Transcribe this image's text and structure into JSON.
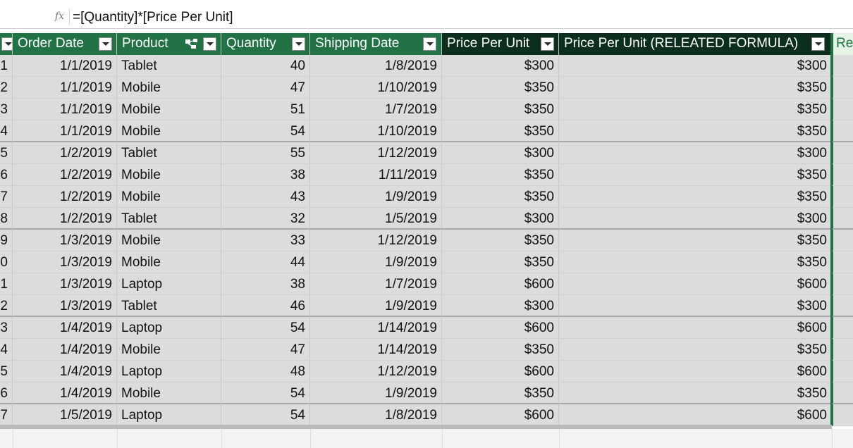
{
  "formula_bar": {
    "fx": "fx",
    "formula": "=[Quantity]*[Price Per Unit]"
  },
  "columns": [
    {
      "key": "id",
      "label": ""
    },
    {
      "key": "order_date",
      "label": "Order Date"
    },
    {
      "key": "product",
      "label": "Product"
    },
    {
      "key": "quantity",
      "label": "Quantity"
    },
    {
      "key": "shipping_date",
      "label": "Shipping Date"
    },
    {
      "key": "price",
      "label": "Price Per Unit"
    },
    {
      "key": "related_price",
      "label": "Price Per Unit (RELEATED FORMULA)"
    },
    {
      "key": "revenue",
      "label": "Rev"
    }
  ],
  "colors": {
    "header_green": "#217346",
    "header_dark": "#0b2f1c",
    "selected_header_bg": "#e4f3e4",
    "selected_header_text": "#217346",
    "cell_bg": "#dcdcdc"
  },
  "rows": [
    {
      "id": "1",
      "order_date": "1/1/2019",
      "product": "Tablet",
      "quantity": "40",
      "shipping_date": "1/8/2019",
      "price": "$300",
      "related_price": "$300"
    },
    {
      "id": "2",
      "order_date": "1/1/2019",
      "product": "Mobile",
      "quantity": "47",
      "shipping_date": "1/10/2019",
      "price": "$350",
      "related_price": "$350"
    },
    {
      "id": "3",
      "order_date": "1/1/2019",
      "product": "Mobile",
      "quantity": "51",
      "shipping_date": "1/7/2019",
      "price": "$350",
      "related_price": "$350"
    },
    {
      "id": "4",
      "order_date": "1/1/2019",
      "product": "Mobile",
      "quantity": "54",
      "shipping_date": "1/10/2019",
      "price": "$350",
      "related_price": "$350"
    },
    {
      "id": "5",
      "order_date": "1/2/2019",
      "product": "Tablet",
      "quantity": "55",
      "shipping_date": "1/12/2019",
      "price": "$300",
      "related_price": "$300"
    },
    {
      "id": "6",
      "order_date": "1/2/2019",
      "product": "Mobile",
      "quantity": "38",
      "shipping_date": "1/11/2019",
      "price": "$350",
      "related_price": "$350"
    },
    {
      "id": "7",
      "order_date": "1/2/2019",
      "product": "Mobile",
      "quantity": "43",
      "shipping_date": "1/9/2019",
      "price": "$350",
      "related_price": "$350"
    },
    {
      "id": "8",
      "order_date": "1/2/2019",
      "product": "Tablet",
      "quantity": "32",
      "shipping_date": "1/5/2019",
      "price": "$300",
      "related_price": "$300"
    },
    {
      "id": "9",
      "order_date": "1/3/2019",
      "product": "Mobile",
      "quantity": "33",
      "shipping_date": "1/12/2019",
      "price": "$350",
      "related_price": "$350"
    },
    {
      "id": "0",
      "order_date": "1/3/2019",
      "product": "Mobile",
      "quantity": "44",
      "shipping_date": "1/9/2019",
      "price": "$350",
      "related_price": "$350"
    },
    {
      "id": "1",
      "order_date": "1/3/2019",
      "product": "Laptop",
      "quantity": "38",
      "shipping_date": "1/7/2019",
      "price": "$600",
      "related_price": "$600"
    },
    {
      "id": "2",
      "order_date": "1/3/2019",
      "product": "Tablet",
      "quantity": "46",
      "shipping_date": "1/9/2019",
      "price": "$300",
      "related_price": "$300"
    },
    {
      "id": "3",
      "order_date": "1/4/2019",
      "product": "Laptop",
      "quantity": "54",
      "shipping_date": "1/14/2019",
      "price": "$600",
      "related_price": "$600"
    },
    {
      "id": "4",
      "order_date": "1/4/2019",
      "product": "Mobile",
      "quantity": "47",
      "shipping_date": "1/14/2019",
      "price": "$350",
      "related_price": "$350"
    },
    {
      "id": "5",
      "order_date": "1/4/2019",
      "product": "Laptop",
      "quantity": "48",
      "shipping_date": "1/12/2019",
      "price": "$600",
      "related_price": "$600"
    },
    {
      "id": "6",
      "order_date": "1/4/2019",
      "product": "Mobile",
      "quantity": "54",
      "shipping_date": "1/9/2019",
      "price": "$350",
      "related_price": "$350"
    },
    {
      "id": "7",
      "order_date": "1/5/2019",
      "product": "Laptop",
      "quantity": "54",
      "shipping_date": "1/8/2019",
      "price": "$600",
      "related_price": "$600"
    }
  ]
}
